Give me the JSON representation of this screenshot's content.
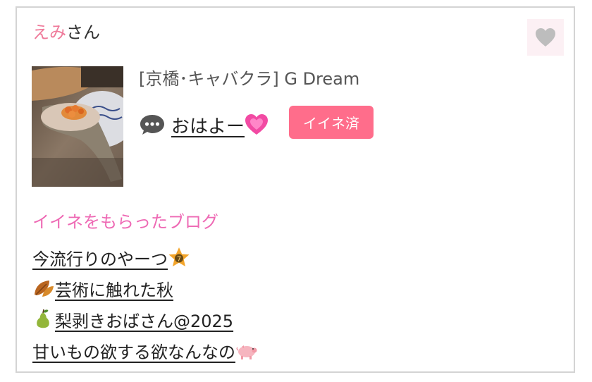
{
  "user": {
    "name_highlight": "えみ",
    "honorific": "さん"
  },
  "like_icon": "heart-icon",
  "post": {
    "shop_label": "[京橋･キャバクラ]  G Dream",
    "message": "おはよー",
    "message_emoji": "growing-heart",
    "liked_button_label": "イイネ済"
  },
  "blogs": {
    "title": "イイネをもらったブログ",
    "items": [
      {
        "text": "今流行りのやーつ",
        "emoji_icon": "star-badge-icon",
        "emoji_position": "after"
      },
      {
        "text": "芸術に触れた秋",
        "emoji_icon": "fallen-leaf-icon",
        "emoji_position": "before"
      },
      {
        "text": "梨剥きおばさん@2025",
        "emoji_icon": "pear-icon",
        "emoji_position": "before"
      },
      {
        "text": "甘いもの欲する欲なんなの",
        "emoji_icon": "pig-icon",
        "emoji_position": "after"
      }
    ]
  },
  "colors": {
    "name_pink": "#ef7a9a",
    "button_pink": "#ff6d8b",
    "section_pink": "#ee69b4",
    "heart_gray": "#bdbdbd",
    "heart_bg": "#fcf0f4"
  }
}
